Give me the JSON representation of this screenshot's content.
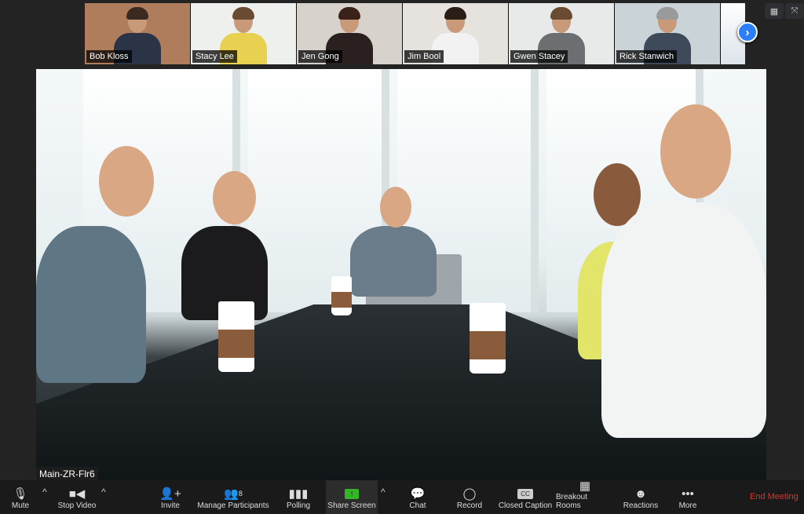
{
  "thumbnails": [
    {
      "name": "Bob Kloss",
      "bg": "#b07d5c",
      "shirt": "#2b3446",
      "hair": "#3a2a20"
    },
    {
      "name": "Stacy Lee",
      "bg": "#eef0ee",
      "shirt": "#e8d050",
      "hair": "#6a4a30"
    },
    {
      "name": "Jen Gong",
      "bg": "#d8d2cc",
      "shirt": "#2a2020",
      "hair": "#3a2218"
    },
    {
      "name": "Jim Bool",
      "bg": "#e6e3df",
      "shirt": "#f2f2f2",
      "hair": "#2a1d16"
    },
    {
      "name": "Gwen Stacey",
      "bg": "#e8eaea",
      "shirt": "#6c6f72",
      "hair": "#6a4a30"
    },
    {
      "name": "Rick Stanwich",
      "bg": "#c9d3d8",
      "shirt": "#3e4a5a",
      "hair": "#9a9a9a"
    }
  ],
  "icons": {
    "next": "chevron-right-icon",
    "gallery": "grid-icon",
    "fullscreen": "fullscreen-icon"
  },
  "main_video": {
    "label": "Main-ZR-Flr6"
  },
  "toolbar": {
    "mute": "Mute",
    "stop_video": "Stop Video",
    "invite": "Invite",
    "manage_participants": "Manage Participants",
    "participant_count": "8",
    "polling": "Polling",
    "share_screen": "Share Screen",
    "chat": "Chat",
    "record": "Record",
    "closed_caption": "Closed Caption",
    "cc_glyph": "CC",
    "breakout_rooms": "Breakout Rooms",
    "reactions": "Reactions",
    "more": "More",
    "end_meeting": "End Meeting"
  },
  "colors": {
    "share_accent": "#34b526",
    "end_meeting": "#e0322a",
    "next_button": "#2d7ff9"
  }
}
